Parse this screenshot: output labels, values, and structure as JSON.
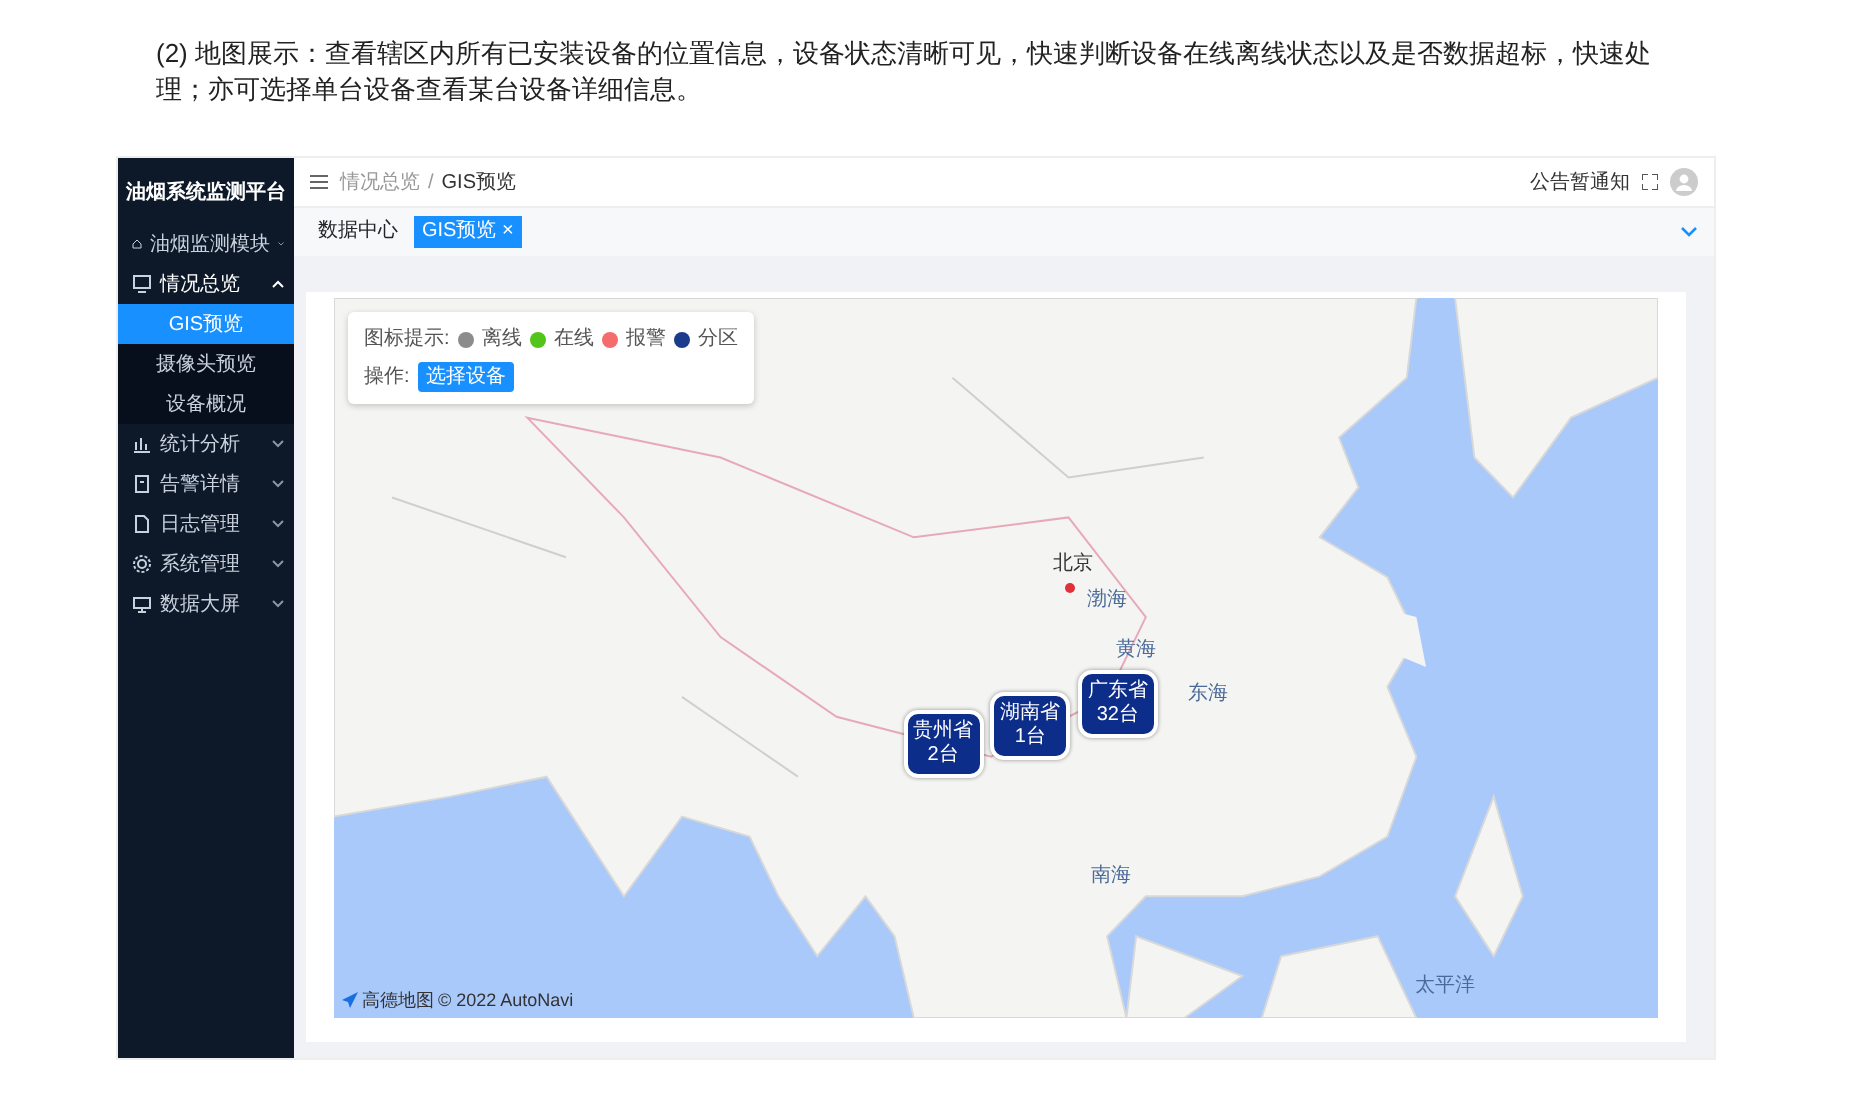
{
  "doc_text": "(2) 地图展示：查看辖区内所有已安装设备的位置信息，设备状态清晰可见，快速判断设备在线离线状态以及是否数据超标，快速处理；亦可选择单台设备查看某台设备详细信息。",
  "app": {
    "sidebar": {
      "title": "油烟系统监测平台",
      "items": [
        {
          "label": "油烟监测模块",
          "expanded": false
        },
        {
          "label": "情况总览",
          "expanded": true,
          "children": [
            {
              "label": "GIS预览",
              "selected": true
            },
            {
              "label": "摄像头预览",
              "selected": false
            },
            {
              "label": "设备概况",
              "selected": false
            }
          ]
        },
        {
          "label": "统计分析",
          "expanded": false
        },
        {
          "label": "告警详情",
          "expanded": false
        },
        {
          "label": "日志管理",
          "expanded": false
        },
        {
          "label": "系统管理",
          "expanded": false
        },
        {
          "label": "数据大屏",
          "expanded": false
        }
      ]
    },
    "breadcrumb": [
      "情况总览",
      "GIS预览"
    ],
    "breadcrumb_separator": "/",
    "notice": "公告暂通知",
    "tabs": [
      {
        "label": "数据中心",
        "selected": false,
        "closable": false
      },
      {
        "label": "GIS预览",
        "selected": true,
        "closable": true
      }
    ],
    "tab_close": "×",
    "legend": {
      "title": "图标提示:",
      "items": [
        {
          "label": "离线",
          "color": "#8c8c8c"
        },
        {
          "label": "在线",
          "color": "#52c41a"
        },
        {
          "label": "报警",
          "color": "#f56c6c"
        },
        {
          "label": "分区",
          "color": "#1b3c8c"
        }
      ],
      "action_label": "操作:",
      "action_button": "选择设备"
    },
    "map": {
      "labels": [
        "北京",
        "渤海",
        "黄海",
        "东海",
        "南海",
        "太平洋"
      ],
      "markers": [
        {
          "name": "贵州省",
          "count": "2台"
        },
        {
          "name": "湖南省",
          "count": "1台"
        },
        {
          "name": "广东省",
          "count": "32台"
        }
      ],
      "attribution_logo": "高德地图",
      "attribution": "© 2022 AutoNavi"
    }
  }
}
